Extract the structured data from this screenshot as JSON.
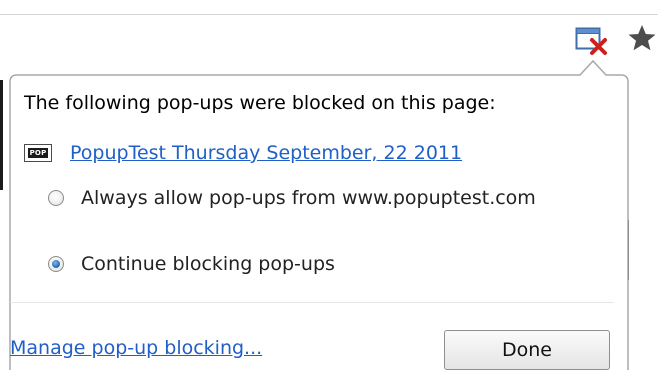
{
  "popup_bubble": {
    "heading": "The following pop-ups were blocked on this page:",
    "blocked_popups": [
      {
        "icon_text": "POP",
        "title": "PopupTest Thursday September, 22 2011"
      }
    ],
    "options": [
      {
        "label": "Always allow pop-ups from www.popuptest.com",
        "selected": false
      },
      {
        "label": "Continue blocking pop-ups",
        "selected": true
      }
    ],
    "manage_link": "Manage pop-up blocking...",
    "done_button": "Done"
  },
  "icons": {
    "popup_blocked": "popup-blocked-icon",
    "bookmark_star": "star-icon"
  },
  "colors": {
    "link": "#1f5fc7",
    "blocked_x": "#cc1f1f",
    "radio_selected": "#2f6fb5"
  }
}
